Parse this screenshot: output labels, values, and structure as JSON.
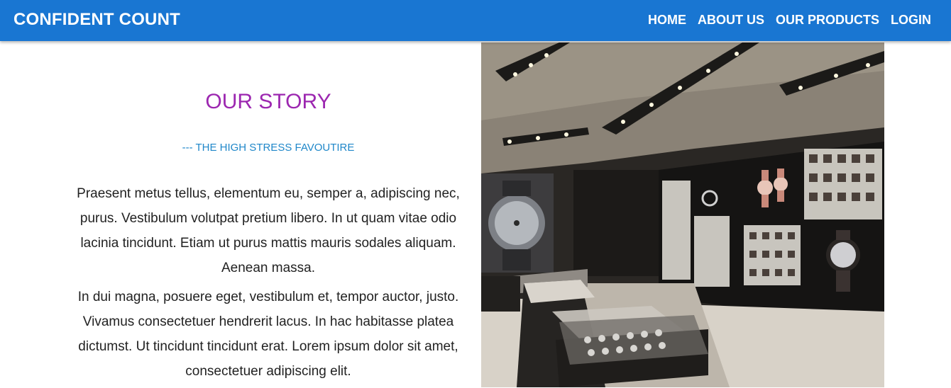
{
  "navbar": {
    "brand": "CONFIDENT COUNT",
    "links": [
      {
        "label": "HOME"
      },
      {
        "label": "ABOUT US"
      },
      {
        "label": "OUR PRODUCTS"
      },
      {
        "label": "LOGIN"
      }
    ]
  },
  "story": {
    "title": "OUR STORY",
    "subtitle": "--- THE HIGH STRESS FAVOUTIRE",
    "paragraphs": [
      "Praesent metus tellus, elementum eu, semper a, adipiscing nec, purus. Vestibulum volutpat pretium libero. In ut quam vitae odio lacinia tincidunt. Etiam ut purus mattis mauris sodales aliquam. Aenean massa.",
      "In dui magna, posuere eget, vestibulum et, tempor auctor, justo. Vivamus consectetuer hendrerit lacus. In hac habitasse platea dictumst. Ut tincidunt tincidunt erat. Lorem ipsum dolor sit amet, consectetuer adipiscing elit."
    ]
  },
  "colors": {
    "navbar": "#1976d2",
    "title": "#9c27b0",
    "subtitle": "#1f87c9",
    "body_text": "#222222"
  }
}
